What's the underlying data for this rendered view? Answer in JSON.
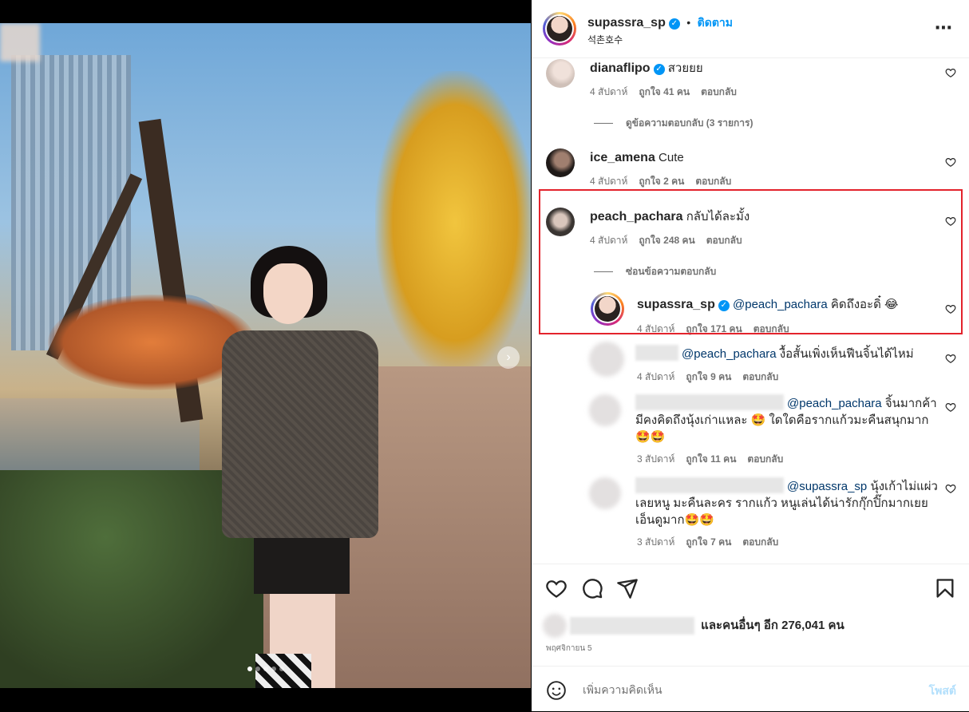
{
  "post": {
    "author": "supassra_sp",
    "follow_label": "ติดตาม",
    "location": "석촌호수",
    "more_label": "..."
  },
  "comments": [
    {
      "user": "dianaflipo",
      "text": "สวยยย",
      "time": "4 สัปดาห์",
      "likes": "ถูกใจ 41 คน",
      "reply": "ตอบกลับ",
      "replies_toggle": "ดูข้อความตอบกลับ (3 รายการ)"
    },
    {
      "user": "ice_amena",
      "text": "Cute",
      "time": "4 สัปดาห์",
      "likes": "ถูกใจ 2 คน",
      "reply": "ตอบกลับ"
    },
    {
      "user": "peach_pachara",
      "text": "กลับได้ละมั้ง",
      "time": "4 สัปดาห์",
      "likes": "ถูกใจ 248 คน",
      "reply": "ตอบกลับ",
      "replies_toggle": "ซ่อนข้อความตอบกลับ"
    }
  ],
  "replies": [
    {
      "user": "supassra_sp",
      "mention": "@peach_pachara",
      "text": "คิดถึงอะดิ๋ 😂",
      "time": "4 สัปดาห์",
      "likes": "ถูกใจ 171 คน",
      "reply": "ตอบกลับ"
    },
    {
      "mention": "@peach_pachara",
      "text": "งื้อสั้นเพิ่งเห็นฟีนจิ้นได้ไหม่",
      "time": "4 สัปดาห์",
      "likes": "ถูกใจ 9 คน",
      "reply": "ตอบกลับ"
    },
    {
      "mention": "@peach_pachara",
      "text_line1": "จิ้นมากค้า",
      "text_line2": "มีคงคิดถึงนุ้งเก่าแหละ 🤩 ใดใดคือรากแก้วมะคืนสนุกมาก",
      "text_line3": "🤩🤩",
      "time": "3 สัปดาห์",
      "likes": "ถูกใจ 11 คน",
      "reply": "ตอบกลับ"
    },
    {
      "mention": "@supassra_sp",
      "text_line1": "นุ้งเก้าไม่แผ่ว",
      "text_line2": "เลยหนู มะคืนละคร รากแก้ว หนูเล่นได้น่ารักกุ๊กปิ๊กมากเยย",
      "text_line3": "เอ็นดูมาก🤩🤩",
      "time": "3 สัปดาห์",
      "likes": "ถูกใจ 7 คน",
      "reply": "ตอบกลับ"
    }
  ],
  "likes_summary": "และคนอื่นๆ อีก 276,041 คน",
  "post_date": "พฤศจิกายน 5",
  "comment_box": {
    "placeholder": "เพิ่มความคิดเห็น",
    "post_label": "โพสต์"
  },
  "carousel": {
    "count": 5,
    "active": 1
  },
  "colors": {
    "accent": "#0095f6",
    "highlight": "#e3232c",
    "mention": "#00376b"
  },
  "icons": [
    "heart-icon",
    "comment-icon",
    "share-icon",
    "bookmark-icon",
    "emoji-icon",
    "verified-icon",
    "more-icon"
  ]
}
